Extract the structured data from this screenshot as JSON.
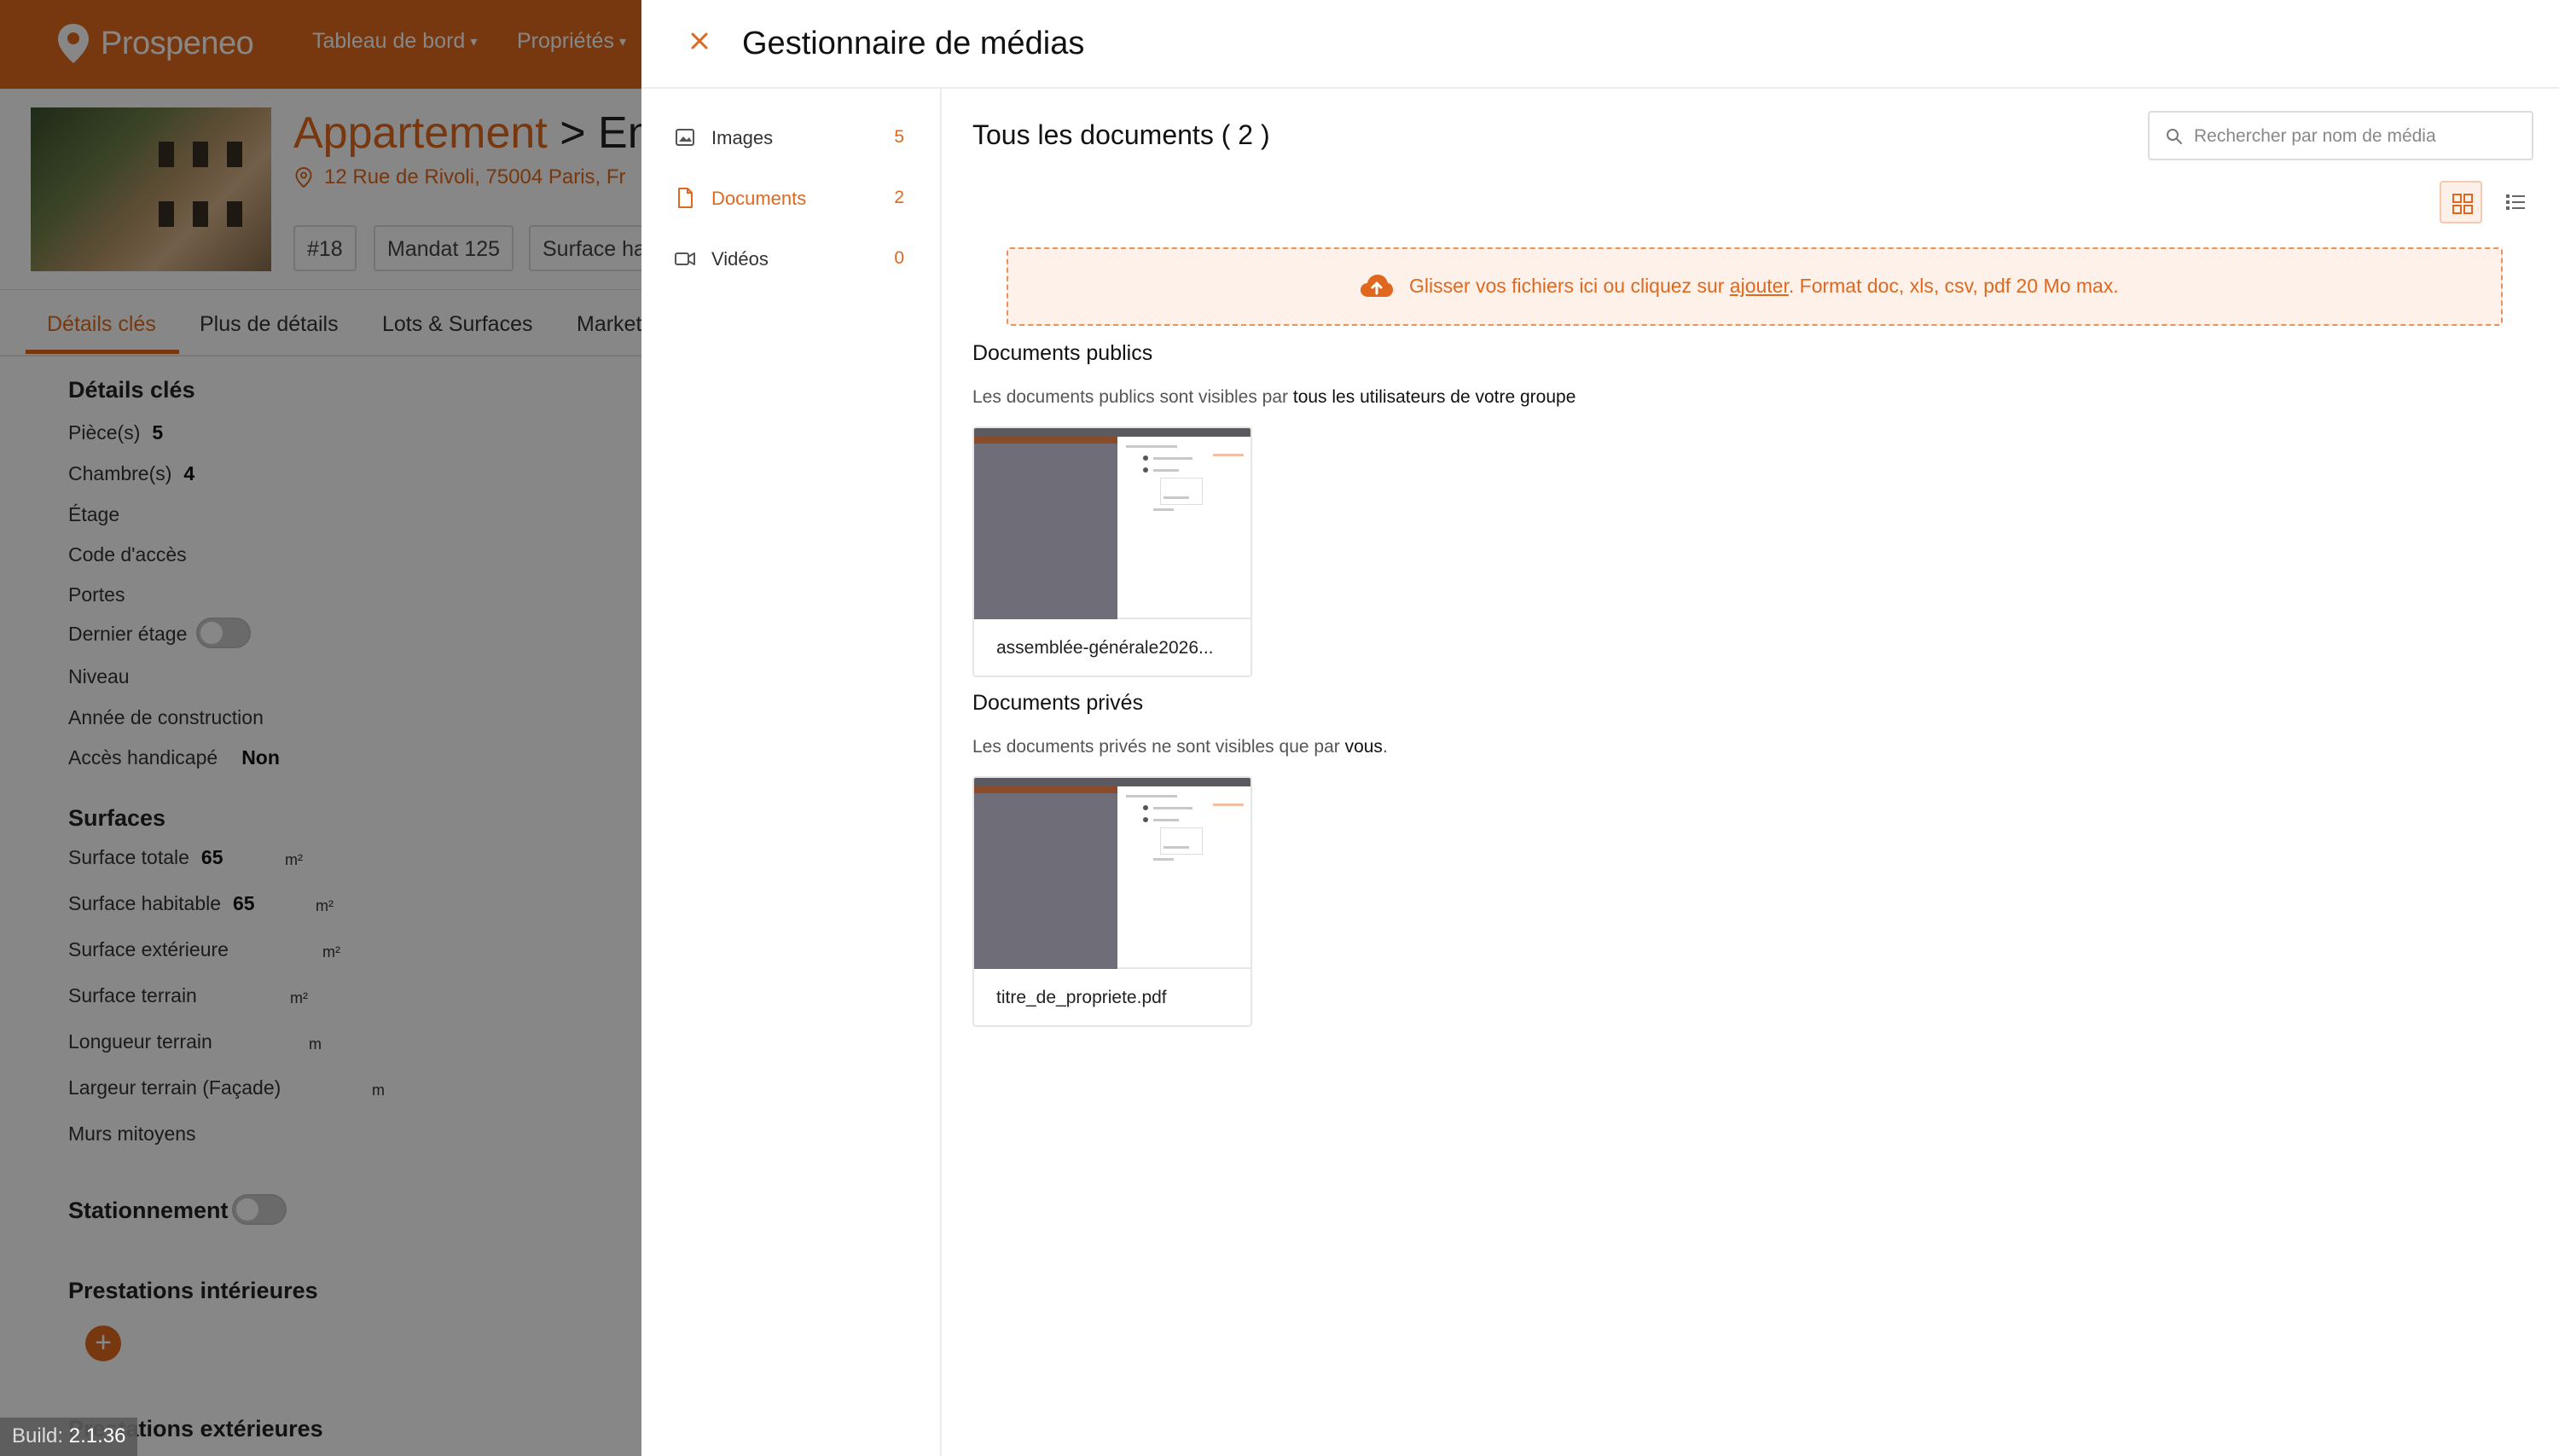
{
  "app": {
    "brand": "Prospeneo",
    "nav": [
      {
        "label": "Tableau de bord"
      },
      {
        "label": "Propriétés"
      }
    ]
  },
  "property": {
    "title_type": "Appartement",
    "title_sep": ">",
    "title_rest": "En",
    "address": "12 Rue de Rivoli, 75004 Paris, Fr",
    "chips": [
      "#18",
      "Mandat 125",
      "Surface ha"
    ]
  },
  "tabs": [
    {
      "label": "Détails clés",
      "active": true
    },
    {
      "label": "Plus de détails"
    },
    {
      "label": "Lots & Surfaces"
    },
    {
      "label": "Market"
    }
  ],
  "details": {
    "title": "Détails clés",
    "rows": [
      {
        "label": "Pièce(s)",
        "value": "5"
      },
      {
        "label": "Chambre(s)",
        "value": "4"
      },
      {
        "label": "Étage",
        "value": ""
      },
      {
        "label": "Code d'accès",
        "value": ""
      },
      {
        "label": "Portes",
        "value": ""
      },
      {
        "label": "Dernier étage",
        "value": ""
      },
      {
        "label": "Niveau",
        "value": ""
      },
      {
        "label": "Année de construction",
        "value": ""
      },
      {
        "label": "Accès handicapé",
        "value": "Non"
      }
    ]
  },
  "surfaces": {
    "title": "Surfaces",
    "rows": [
      {
        "label": "Surface totale",
        "value": "65",
        "unit": "m²"
      },
      {
        "label": "Surface habitable",
        "value": "65",
        "unit": "m²"
      },
      {
        "label": "Surface extérieure",
        "value": "",
        "unit": "m²"
      },
      {
        "label": "Surface terrain",
        "value": "",
        "unit": "m²"
      },
      {
        "label": "Longueur terrain",
        "value": "",
        "unit": "m"
      },
      {
        "label": "Largeur terrain (Façade)",
        "value": "",
        "unit": "m"
      },
      {
        "label": "Murs mitoyens",
        "value": "",
        "unit": ""
      }
    ]
  },
  "parking": {
    "title": "Stationnement"
  },
  "interior": {
    "title": "Prestations intérieures",
    "add_label": "+"
  },
  "exterior": {
    "title": "Prestations extérieures"
  },
  "build": {
    "label": "Build:",
    "version": "2.1.36"
  },
  "media_manager": {
    "title": "Gestionnaire de médias",
    "sidebar": [
      {
        "label": "Images",
        "count": "5",
        "icon": "image-icon"
      },
      {
        "label": "Documents",
        "count": "2",
        "icon": "document-icon",
        "active": true
      },
      {
        "label": "Vidéos",
        "count": "0",
        "icon": "video-icon"
      }
    ],
    "main_title": "Tous les documents ( 2 )",
    "search_placeholder": "Rechercher par nom de média",
    "dropzone": {
      "before": "Glisser vos fichiers ici ou cliquez sur ",
      "link": "ajouter",
      "after": ". Format doc, xls, csv, pdf 20 Mo max."
    },
    "public": {
      "title": "Documents publics",
      "desc_before": "Les documents publics sont visibles par ",
      "desc_bold": "tous les utilisateurs de votre groupe",
      "files": [
        "assemblée-générale2026..."
      ]
    },
    "private": {
      "title": "Documents privés",
      "desc_before": "Les documents privés ne sont visibles que par ",
      "desc_bold": "vous",
      "desc_after": ".",
      "files": [
        "titre_de_propriete.pdf"
      ]
    }
  },
  "colors": {
    "accent": "#e0681e",
    "overlay": "rgba(0,0,0,0.47)"
  }
}
